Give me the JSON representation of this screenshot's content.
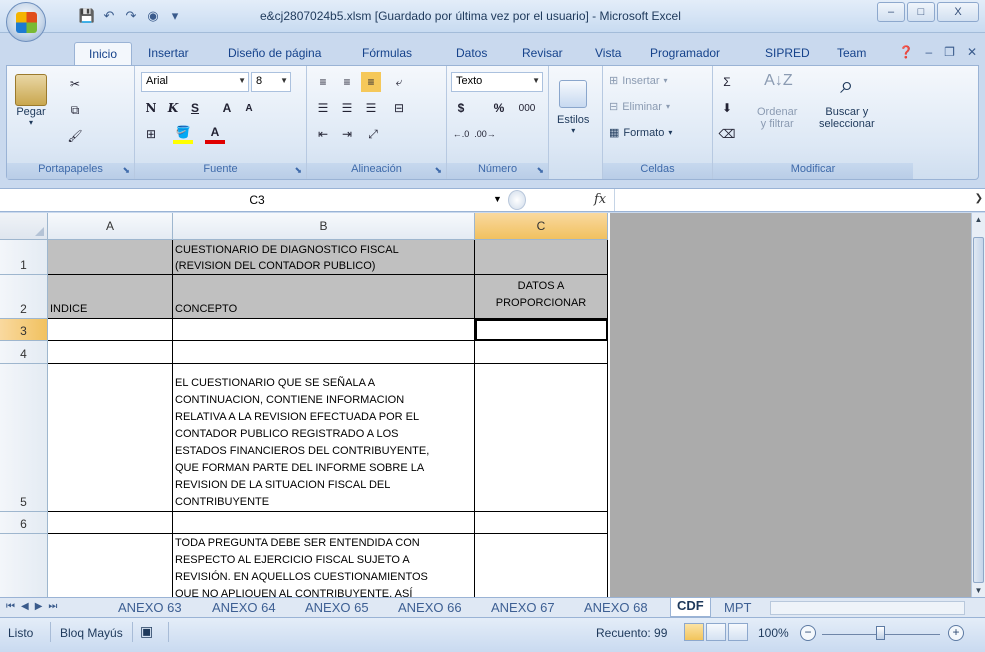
{
  "window": {
    "title": "e&cj2807024b5.xlsm [Guardado por última vez por el usuario] - Microsoft Excel",
    "controls": [
      "–",
      "□",
      "X"
    ]
  },
  "ribbon_tabs": [
    "Inicio",
    "Insertar",
    "Diseño de página",
    "Fórmulas",
    "Datos",
    "Revisar",
    "Vista",
    "Programador",
    "SIPRED",
    "Team"
  ],
  "active_tab": "Inicio",
  "ribbon": {
    "portapapeles": {
      "label": "Portapapeles",
      "paste": "Pegar"
    },
    "fuente": {
      "label": "Fuente",
      "font_name": "Arial",
      "font_size": "8",
      "bold": "N",
      "italic": "K",
      "underline": "S",
      "grow": "A",
      "shrink": "A",
      "font_color": "A"
    },
    "alineacion": {
      "label": "Alineación"
    },
    "numero": {
      "label": "Número",
      "format": "Texto",
      "currency": "$",
      "percent": "%",
      "thousands": "000"
    },
    "estilos": {
      "label": "Estilos"
    },
    "celdas": {
      "label": "Celdas",
      "insert": "Insertar",
      "delete": "Eliminar",
      "format": "Formato"
    },
    "modificar": {
      "label": "Modificar",
      "sort_line1": "Ordenar",
      "sort_line2": "y filtrar",
      "find_line1": "Buscar y",
      "find_line2": "seleccionar"
    }
  },
  "formula_bar": {
    "name_box": "C3",
    "fx": "fx",
    "formula": ""
  },
  "columns": [
    "A",
    "B",
    "C"
  ],
  "rows": [
    {
      "num": "1",
      "a": "",
      "b": "CUESTIONARIO DE DIAGNOSTICO FISCAL\n(REVISION DEL CONTADOR PUBLICO)",
      "c": ""
    },
    {
      "num": "2",
      "a": "INDICE",
      "b": "CONCEPTO",
      "c": "DATOS A\nPROPORCIONAR"
    },
    {
      "num": "3",
      "a": "",
      "b": "",
      "c": ""
    },
    {
      "num": "4",
      "a": "",
      "b": "",
      "c": ""
    },
    {
      "num": "5",
      "a": "",
      "b": "EL CUESTIONARIO QUE SE SEÑALA A\nCONTINUACION, CONTIENE INFORMACION\nRELATIVA A LA REVISION EFECTUADA POR EL\nCONTADOR PUBLICO REGISTRADO A LOS\nESTADOS FINANCIEROS DEL CONTRIBUYENTE,\nQUE FORMAN PARTE DEL INFORME SOBRE LA\nREVISION DE LA SITUACION FISCAL DEL\nCONTRIBUYENTE",
      "c": ""
    },
    {
      "num": "6",
      "a": "",
      "b": "",
      "c": ""
    },
    {
      "num": "",
      "a": "",
      "b": "TODA PREGUNTA DEBE SER ENTENDIDA CON\nRESPECTO AL EJERCICIO FISCAL SUJETO A\nREVISIÓN. EN AQUELLOS CUESTIONAMIENTOS\nQUE NO APLIQUEN AL CONTRIBUYENTE, ASÍ",
      "c": ""
    }
  ],
  "sheet_tabs": [
    "ANEXO 63",
    "ANEXO 64",
    "ANEXO 65",
    "ANEXO 66",
    "ANEXO 67",
    "ANEXO 68",
    "CDF",
    "MPT"
  ],
  "active_sheet": "CDF",
  "status": {
    "ready": "Listo",
    "caps": "Bloq Mayús",
    "count": "Recuento: 99",
    "zoom": "100%"
  }
}
